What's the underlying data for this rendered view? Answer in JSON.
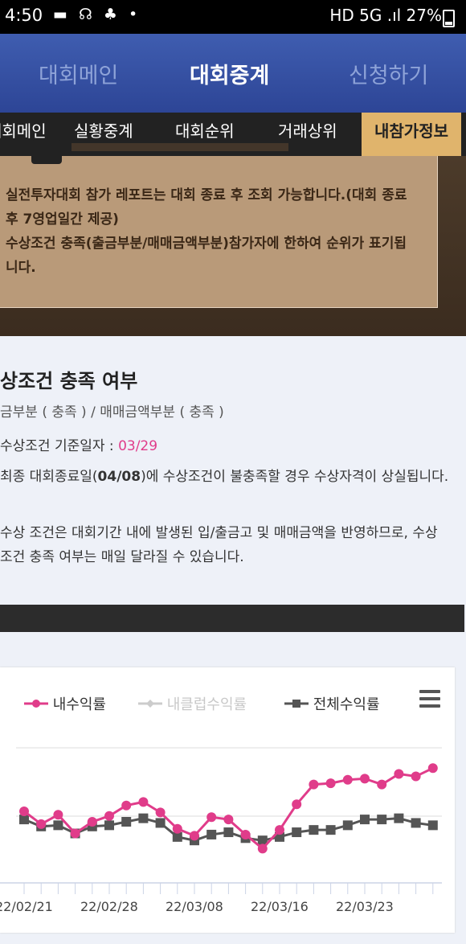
{
  "status_bar": {
    "time": "4:50",
    "right": "HD 5G .ıl 27%"
  },
  "top_nav": {
    "tabs": [
      {
        "label": "대회메인",
        "active": false
      },
      {
        "label": "대회중계",
        "active": true
      },
      {
        "label": "신청하기",
        "active": false
      }
    ]
  },
  "sub_nav": {
    "items": [
      {
        "label": "대회메인",
        "active": false
      },
      {
        "label": "실황중계",
        "active": false
      },
      {
        "label": "대회순위",
        "active": false
      },
      {
        "label": "거래상위",
        "active": false
      },
      {
        "label": "내참가정보",
        "active": true
      }
    ]
  },
  "notice": {
    "line1": "실전투자대회 참가 레포트는 대회 종료 후 조회 가능합니다.(대회 종료 후 7영업일간 제공)",
    "line2": "수상조건 충족(출금부분/매매금액부분)참가자에 한하여 순위가 표기됩니다."
  },
  "award_status": {
    "title": "상조건 충족 여부",
    "summary": "금부분 ( 충족 ) / 매매금액부분 ( 충족 )",
    "base_date_label": "수상조건 기준일자 : ",
    "base_date": "03/29",
    "final_prefix": "최종 대회종료일(",
    "final_date": "04/08",
    "final_suffix": ")에 수상조건이 불충족할 경우 수상자격이 상실됩니다.",
    "note": "수상 조건은 대회기간 내에 발생된 입/출금고 및 매매금액을 반영하므로, 수상조건 충족 여부는 매일 달라질 수 있습니다."
  },
  "chart_data": {
    "type": "line",
    "legend": [
      "내수익률",
      "내클럽수익률",
      "전체수익률"
    ],
    "x_tick_labels": [
      "22/02/21",
      "22/02/28",
      "22/03/08",
      "22/03/16",
      "22/03/23"
    ],
    "colors": {
      "mine": "#e03c8a",
      "club": "#cccccc",
      "total": "#555555"
    },
    "series": [
      {
        "name": "내수익률",
        "values": [
          49,
          38,
          46,
          30,
          40,
          45,
          54,
          57,
          48,
          34,
          28,
          44,
          42,
          29,
          17,
          33,
          55,
          72,
          73,
          76,
          77,
          72,
          81,
          79,
          86
        ]
      },
      {
        "name": "전체수익률",
        "values": [
          42,
          36,
          37,
          30,
          36,
          37,
          40,
          43,
          39,
          27,
          24,
          29,
          31,
          26,
          24,
          27,
          31,
          33,
          33,
          37,
          42,
          42,
          43,
          39,
          37
        ]
      }
    ]
  }
}
